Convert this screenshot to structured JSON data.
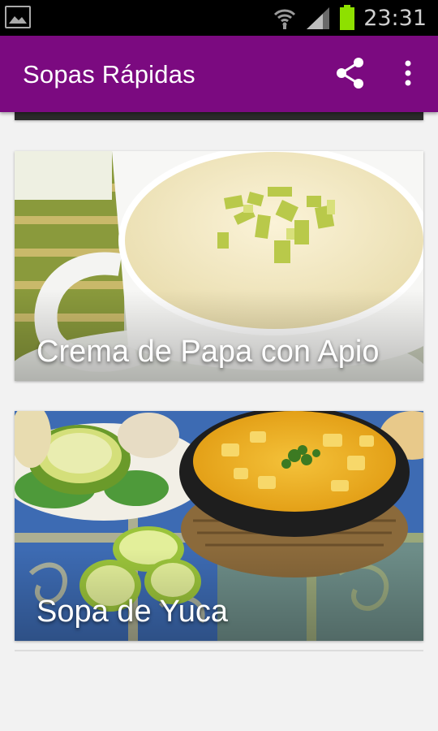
{
  "status_bar": {
    "time": "23:31",
    "icons": [
      "image-icon",
      "wifi-icon",
      "signal-icon",
      "battery-icon"
    ],
    "battery_color": "#8ee000"
  },
  "app_bar": {
    "title": "Sopas Rápidas",
    "background_color": "#7b0a80",
    "actions": [
      "share-icon",
      "more-vert-icon"
    ]
  },
  "recipes": [
    {
      "title": "Crema de Papa con Apio"
    },
    {
      "title": "Sopa de Yuca"
    }
  ]
}
